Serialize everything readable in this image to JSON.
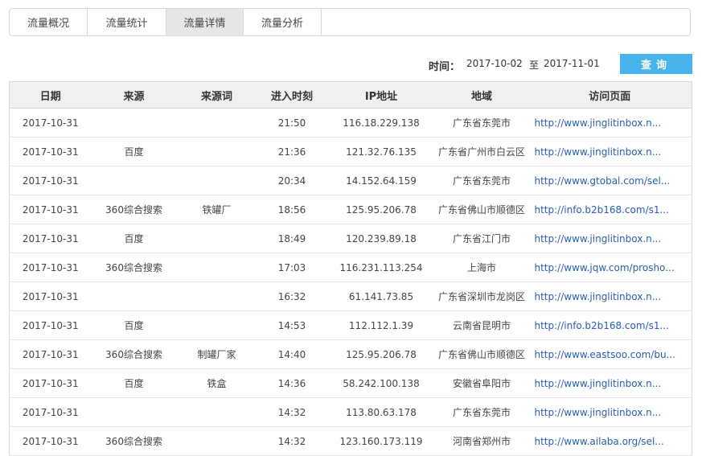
{
  "tabs": [
    {
      "label": "流量概况",
      "active": false
    },
    {
      "label": "流量统计",
      "active": false
    },
    {
      "label": "流量详情",
      "active": true
    },
    {
      "label": "流量分析",
      "active": false
    }
  ],
  "query": {
    "time_label": "时间：",
    "start_date": "2017-10-02",
    "separator": "至",
    "end_date": "2017-11-01",
    "button_label": "查询"
  },
  "table": {
    "columns": [
      "日期",
      "来源",
      "来源词",
      "进入时刻",
      "IP地址",
      "地域",
      "访问页面"
    ],
    "rows": [
      [
        "2017-10-31",
        "",
        "",
        "21:50",
        "116.18.229.138",
        "广东省东莞市",
        "http://www.jinglitinbox.n..."
      ],
      [
        "2017-10-31",
        "百度",
        "",
        "21:36",
        "121.32.76.135",
        "广东省广州市白云区",
        "http://www.jinglitinbox.n..."
      ],
      [
        "2017-10-31",
        "",
        "",
        "20:34",
        "14.152.64.159",
        "广东省东莞市",
        "http://www.gtobal.com/sel..."
      ],
      [
        "2017-10-31",
        "360综合搜索",
        "铁罐厂",
        "18:56",
        "125.95.206.78",
        "广东省佛山市顺德区",
        "http://info.b2b168.com/s1..."
      ],
      [
        "2017-10-31",
        "百度",
        "",
        "18:49",
        "120.239.89.18",
        "广东省江门市",
        "http://www.jinglitinbox.n..."
      ],
      [
        "2017-10-31",
        "360综合搜索",
        "",
        "17:03",
        "116.231.113.254",
        "上海市",
        "http://www.jqw.com/prosho..."
      ],
      [
        "2017-10-31",
        "",
        "",
        "16:32",
        "61.141.73.85",
        "广东省深圳市龙岗区",
        "http://www.jinglitinbox.n..."
      ],
      [
        "2017-10-31",
        "百度",
        "",
        "14:53",
        "112.112.1.39",
        "云南省昆明市",
        "http://info.b2b168.com/s1..."
      ],
      [
        "2017-10-31",
        "360综合搜索",
        "制罐厂家",
        "14:40",
        "125.95.206.78",
        "广东省佛山市顺德区",
        "http://www.eastsoo.com/bu..."
      ],
      [
        "2017-10-31",
        "百度",
        "铁盒",
        "14:36",
        "58.242.100.138",
        "安徽省阜阳市",
        "http://www.jinglitinbox.n..."
      ],
      [
        "2017-10-31",
        "",
        "",
        "14:32",
        "113.80.63.178",
        "广东省东莞市",
        "http://www.jinglitinbox.n..."
      ],
      [
        "2017-10-31",
        "360综合搜索",
        "",
        "14:32",
        "123.160.173.119",
        "河南省郑州市",
        "http://www.ailaba.org/sel..."
      ]
    ]
  }
}
